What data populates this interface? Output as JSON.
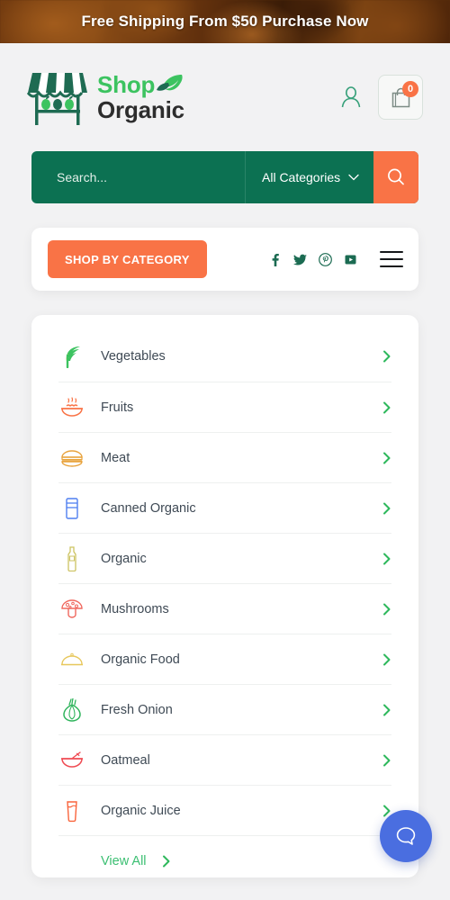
{
  "promo": {
    "text": "Free Shipping From $50 Purchase Now"
  },
  "header": {
    "logo": {
      "shop_text": "Shop",
      "organic_text": "Organic",
      "mark_icon": "market-stall-icon",
      "leaf_icon": "leaf-icon"
    },
    "account_icon": "user-account-icon",
    "cart_icon": "shopping-bag-icon",
    "cart_count": "0"
  },
  "search": {
    "placeholder": "Search...",
    "value": "",
    "category_selected": "All Categories",
    "chevron_icon": "chevron-down-icon",
    "button_icon": "search-icon"
  },
  "catbar": {
    "shop_by_category_label": "SHOP BY CATEGORY",
    "social": [
      {
        "name": "facebook-icon",
        "label": "Facebook"
      },
      {
        "name": "twitter-icon",
        "label": "Twitter"
      },
      {
        "name": "pinterest-icon",
        "label": "Pinterest"
      },
      {
        "name": "youtube-icon",
        "label": "YouTube"
      }
    ],
    "menu_icon": "hamburger-menu-icon"
  },
  "categories": {
    "items": [
      {
        "label": "Vegetables",
        "icon": "leafy-greens-icon",
        "color": "#3cc360"
      },
      {
        "label": "Fruits",
        "icon": "fruit-bowl-icon",
        "color": "#f97346"
      },
      {
        "label": "Meat",
        "icon": "burger-icon",
        "color": "#e8a33d"
      },
      {
        "label": "Canned Organic",
        "icon": "can-icon",
        "color": "#4f7ff0"
      },
      {
        "label": "Organic",
        "icon": "bottle-icon",
        "color": "#cdc362"
      },
      {
        "label": "Mushrooms",
        "icon": "mushroom-icon",
        "color": "#f0685e"
      },
      {
        "label": "Organic Food",
        "icon": "food-cloche-icon",
        "color": "#e7c75b"
      },
      {
        "label": "Fresh Onion",
        "icon": "onion-icon",
        "color": "#2fb45c"
      },
      {
        "label": "Oatmeal",
        "icon": "oatmeal-bowl-icon",
        "color": "#ef4b53"
      },
      {
        "label": "Organic Juice",
        "icon": "juice-glass-icon",
        "color": "#f9643c"
      }
    ],
    "row_chevron_icon": "chevron-right-icon",
    "view_all_label": "View All",
    "view_all_chevron_icon": "chevron-right-icon"
  },
  "chat": {
    "icon": "chat-bubble-icon"
  },
  "colors": {
    "accent_orange": "#f97346",
    "brand_green": "#0c7152",
    "logo_green": "#3cc360",
    "link_green": "#3bbf72",
    "chat_blue": "#4a6ee0",
    "page_bg": "#f2f2f3",
    "banner_brown": "#5a2f0c"
  }
}
